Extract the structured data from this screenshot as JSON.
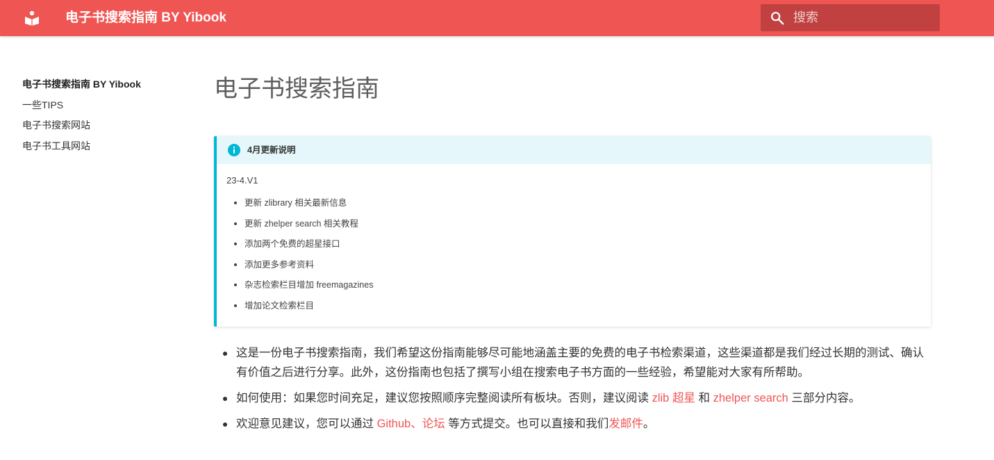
{
  "header": {
    "title": "电子书搜索指南 BY Yibook",
    "logo_icon": "book-reader-icon",
    "search_icon": "search-icon",
    "search_placeholder": "搜索",
    "background_color": "#ef5552"
  },
  "sidebar": {
    "items": [
      {
        "label": "电子书搜索指南 BY Yibook",
        "active": true
      },
      {
        "label": "一些TIPS",
        "active": false
      },
      {
        "label": "电子书搜索网站",
        "active": false
      },
      {
        "label": "电子书工具网站",
        "active": false
      }
    ]
  },
  "main": {
    "page_title": "电子书搜索指南",
    "notice": {
      "icon": "info-icon",
      "title": "4月更新说明",
      "version": "23-4.V1",
      "items": [
        "更新 zlibrary 相关最新信息",
        "更新 zhelper search 相关教程",
        "添加两个免费的超星接口",
        "添加更多参考资料",
        "杂志检索栏目增加 freemagazines",
        "增加论文检索栏目"
      ],
      "accent_color": "#00b8d4"
    },
    "intro": {
      "p1": "这是一份电子书搜索指南，我们希望这份指南能够尽可能地涵盖主要的免费的电子书检索渠道，这些渠道都是我们经过长期的测试、确认有价值之后进行分享。此外，这份指南也包括了撰写小组在搜索电子书方面的一些经验，希望能对大家有所帮助。",
      "p2": {
        "prefix": "如何使用：如果您时间充足，建议您按照顺序完整阅读所有板块。否则，建议阅读 ",
        "link1": "zlib",
        "sep1": " ",
        "link2": "超星",
        "mid": " 和 ",
        "link3": "zhelper search",
        "suffix": " 三部分内容。"
      },
      "p3": {
        "prefix": "欢迎意见建议，您可以通过 ",
        "link1": "Github",
        "sep": "、",
        "link2": "论坛",
        "mid": " 等方式提交。也可以直接和我们",
        "link3": "发邮件",
        "suffix": "。"
      }
    }
  }
}
